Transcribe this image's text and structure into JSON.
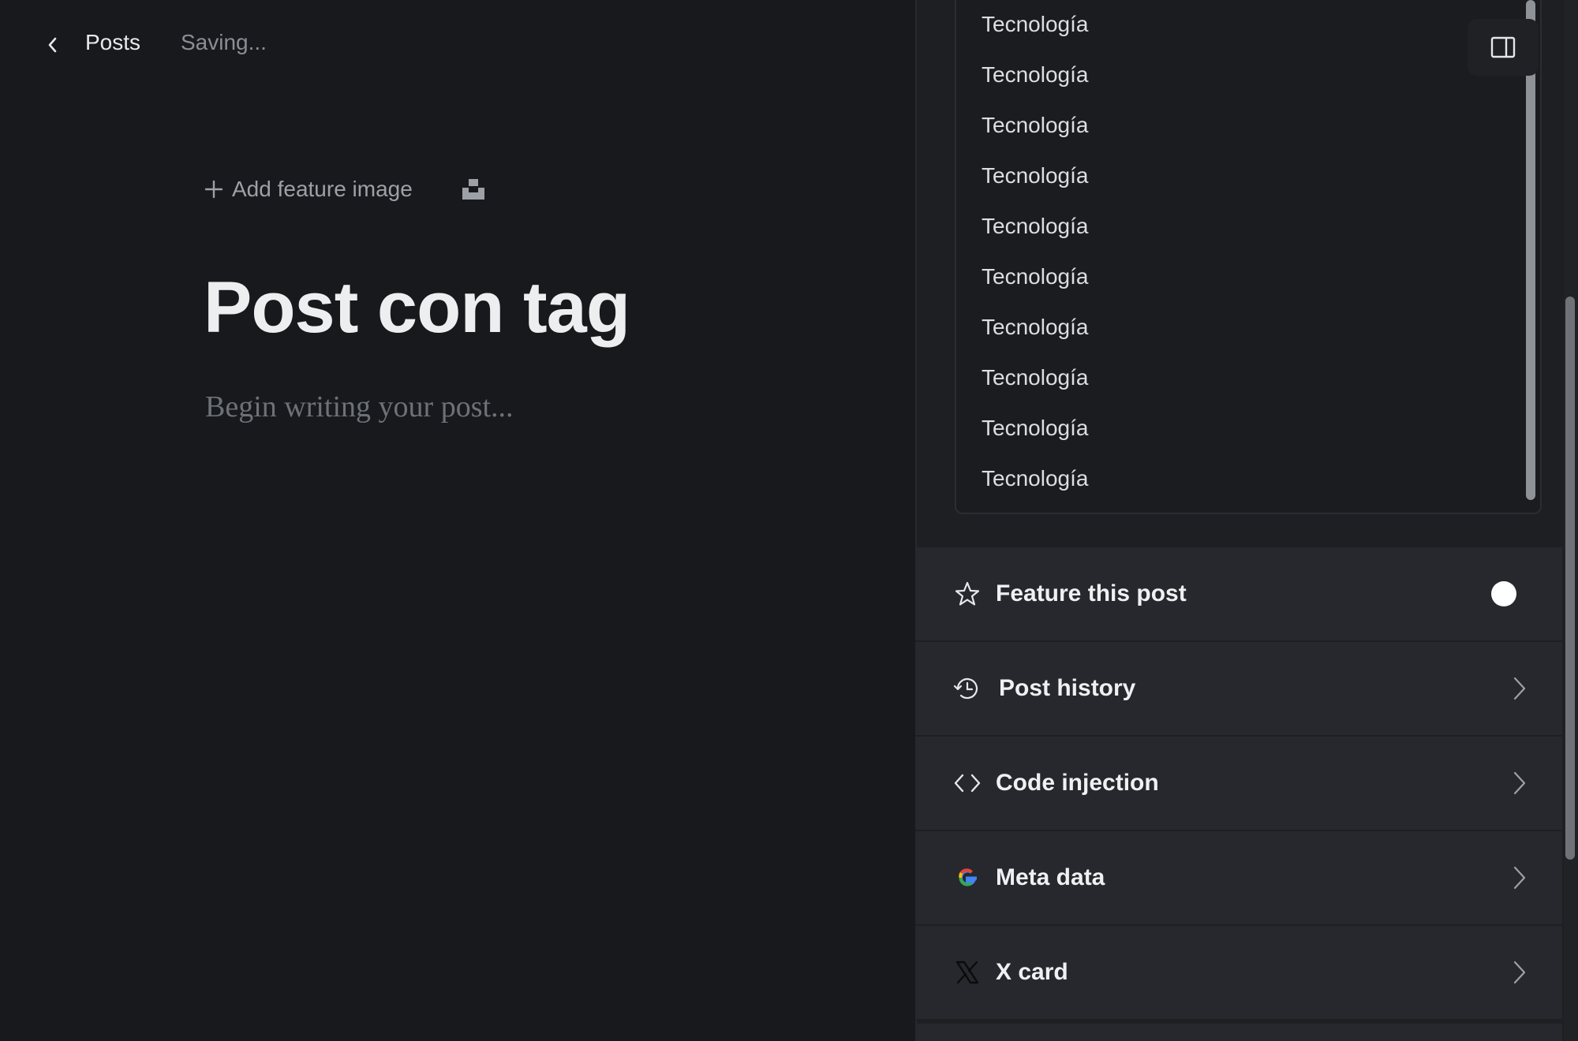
{
  "header": {
    "back_label": "Posts",
    "status": "Saving..."
  },
  "editor": {
    "feature_image_label": "Add feature image",
    "title": "Post con tag",
    "body_placeholder": "Begin writing your post..."
  },
  "tag_dropdown": {
    "options": [
      "Tecnología",
      "Tecnología",
      "Tecnología",
      "Tecnología",
      "Tecnología",
      "Tecnología",
      "Tecnología",
      "Tecnología",
      "Tecnología",
      "Tecnología"
    ]
  },
  "settings": {
    "feature_post": {
      "label": "Feature this post",
      "enabled": false
    },
    "post_history": {
      "label": "Post history"
    },
    "code_injection": {
      "label": "Code injection"
    },
    "meta_data": {
      "label": "Meta data"
    },
    "x_card": {
      "label": "X card"
    }
  },
  "icons": {
    "back": "chevron-left-icon",
    "plus": "plus-icon",
    "unsplash": "unsplash-icon",
    "panel_toggle": "sidebar-toggle-icon",
    "star": "star-icon",
    "history": "history-icon",
    "code": "code-icon",
    "google": "google-icon",
    "x": "x-logo-icon",
    "chevron": "chevron-right-icon"
  }
}
